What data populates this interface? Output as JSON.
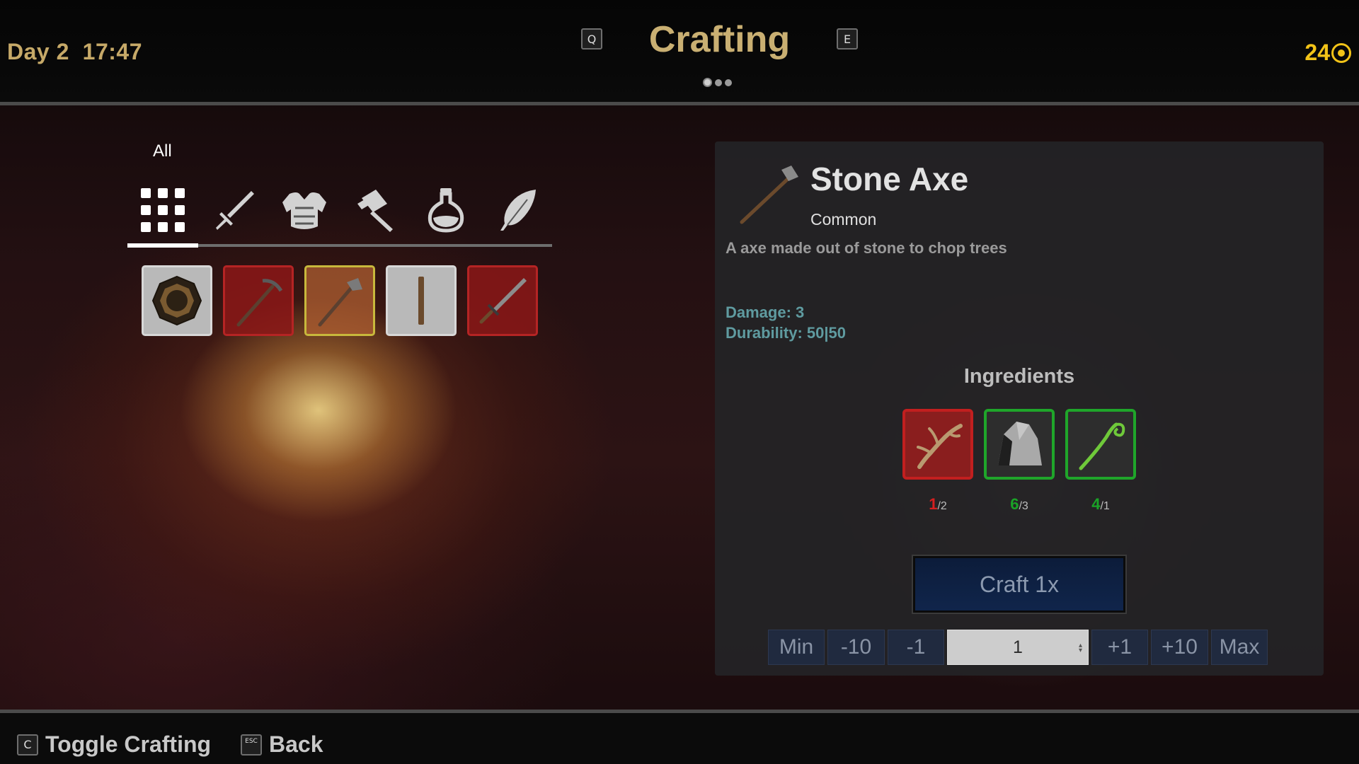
{
  "header": {
    "day": "Day 2",
    "time": "17:47",
    "title": "Crafting",
    "prev_key": "Q",
    "next_key": "E",
    "page_indicator": {
      "pages": 3,
      "active_index": 0
    },
    "gold": "24",
    "gold_icon": "coin-icon"
  },
  "categories": {
    "selected_label": "All",
    "tabs": [
      {
        "name": "all",
        "icon": "grid-icon"
      },
      {
        "name": "weapons",
        "icon": "sword-icon"
      },
      {
        "name": "armor",
        "icon": "chestplate-icon"
      },
      {
        "name": "tools",
        "icon": "hammer-icon"
      },
      {
        "name": "potions",
        "icon": "potion-flask-icon"
      },
      {
        "name": "misc",
        "icon": "feather-icon"
      }
    ]
  },
  "recipes": [
    {
      "icon": "wooden-shield-icon",
      "state": "grey"
    },
    {
      "icon": "pickaxe-icon",
      "state": "red"
    },
    {
      "icon": "stone-axe-icon",
      "state": "yellow-selected"
    },
    {
      "icon": "wooden-stick-icon",
      "state": "grey"
    },
    {
      "icon": "sword-item-icon",
      "state": "red"
    }
  ],
  "detail": {
    "name": "Stone Axe",
    "rarity": "Common",
    "description": "A axe made out of stone to chop trees",
    "stats": {
      "damage": "Damage: 3",
      "durability": "Durability: 50|50"
    },
    "ingredients_title": "Ingredients",
    "ingredients": [
      {
        "icon": "branch-icon",
        "have": "1",
        "need": "/2",
        "status": "red"
      },
      {
        "icon": "stone-icon",
        "have": "6",
        "need": "/3",
        "status": "green"
      },
      {
        "icon": "vine-icon",
        "have": "4",
        "need": "/1",
        "status": "green"
      }
    ],
    "craft_label": "Craft 1x",
    "quantity": {
      "min": "Min",
      "minus10": "-10",
      "minus1": "-1",
      "value": "1",
      "plus1": "+1",
      "plus10": "+10",
      "max": "Max"
    }
  },
  "footer": {
    "toggle_key": "C",
    "toggle_label": "Toggle Crafting",
    "back_key": "ESC",
    "back_label": "Back"
  },
  "colors": {
    "accent_gold": "#c9af72",
    "currency": "#f2c318",
    "missing": "#d61f1f",
    "available": "#1aa327",
    "stat_text": "#5f9ba0"
  }
}
